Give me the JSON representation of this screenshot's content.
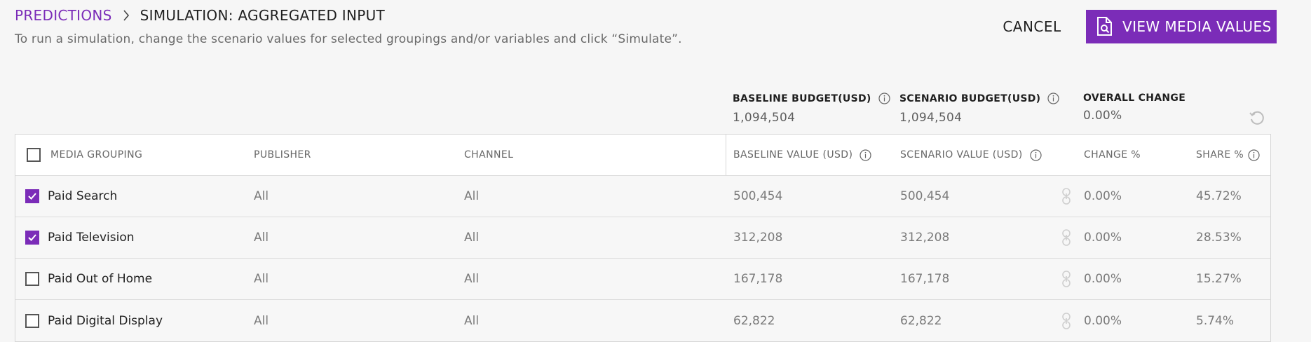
{
  "breadcrumb": {
    "parent": "PREDICTIONS",
    "current": "SIMULATION: AGGREGATED INPUT"
  },
  "subtitle": "To run a simulation, change the scenario values for selected groupings and/or variables and click “Simulate”.",
  "actions": {
    "cancel_label": "CANCEL",
    "view_label": "VIEW MEDIA VALUES"
  },
  "summary": {
    "baseline_label": "BASELINE BUDGET(USD)",
    "baseline_value": "1,094,504",
    "scenario_label": "SCENARIO BUDGET(USD)",
    "scenario_value": "1,094,504",
    "overall_label": "OVERALL CHANGE",
    "overall_value": "0.00%"
  },
  "table": {
    "headers": {
      "media_grouping": "MEDIA GROUPING",
      "publisher": "PUBLISHER",
      "channel": "CHANNEL",
      "baseline_value": "BASELINE VALUE (USD)",
      "scenario_value": "SCENARIO VALUE (USD)",
      "change": "CHANGE %",
      "share": "SHARE %"
    },
    "rows": [
      {
        "name": "Paid Search",
        "checked": true,
        "publisher": "All",
        "channel": "All",
        "baseline": "500,454",
        "scenario": "500,454",
        "change": "0.00%",
        "share": "45.72%"
      },
      {
        "name": "Paid Television",
        "checked": true,
        "publisher": "All",
        "channel": "All",
        "baseline": "312,208",
        "scenario": "312,208",
        "change": "0.00%",
        "share": "28.53%"
      },
      {
        "name": "Paid Out of Home",
        "checked": false,
        "publisher": "All",
        "channel": "All",
        "baseline": "167,178",
        "scenario": "167,178",
        "change": "0.00%",
        "share": "15.27%"
      },
      {
        "name": "Paid Digital Display",
        "checked": false,
        "publisher": "All",
        "channel": "All",
        "baseline": "62,822",
        "scenario": "62,822",
        "change": "0.00%",
        "share": "5.74%"
      }
    ]
  },
  "colors": {
    "accent": "#7b2cb8"
  },
  "icons": {
    "view_button": "document-search-icon",
    "info": "info-icon",
    "reset": "reset-icon",
    "link": "link-icon"
  }
}
